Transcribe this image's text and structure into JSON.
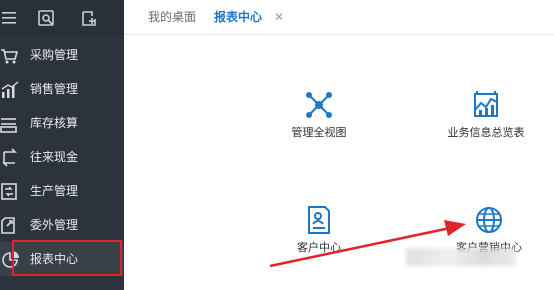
{
  "colors": {
    "sidebar_bg": "#2d333c",
    "accent": "#1e78c8",
    "highlight_red": "#e0242b",
    "tile_icon": "#1e78c8"
  },
  "toolbar": {
    "icons": [
      "menu-icon",
      "home-icon",
      "new-tab-icon"
    ]
  },
  "sidebar": {
    "items": [
      {
        "label": "采购管理",
        "icon": "cart-icon"
      },
      {
        "label": "销售管理",
        "icon": "sales-chart-icon"
      },
      {
        "label": "库存核算",
        "icon": "inventory-icon"
      },
      {
        "label": "往来现金",
        "icon": "exchange-icon"
      },
      {
        "label": "生产管理",
        "icon": "production-icon"
      },
      {
        "label": "委外管理",
        "icon": "outsource-icon"
      },
      {
        "label": "报表中心",
        "icon": "report-icon",
        "active": true
      }
    ]
  },
  "tabs": [
    {
      "label": "我的桌面",
      "active": false
    },
    {
      "label": "报表中心",
      "active": true,
      "closable": true
    }
  ],
  "tab_close_glyph": "✕",
  "tiles": [
    {
      "label": "管理全视图",
      "icon": "network-icon"
    },
    {
      "label": "业务信息总览表",
      "icon": "business-chart-icon"
    },
    {
      "label": "客户中心",
      "icon": "customer-document-icon"
    },
    {
      "label": "客户营销中心",
      "icon": "globe-icon"
    }
  ]
}
